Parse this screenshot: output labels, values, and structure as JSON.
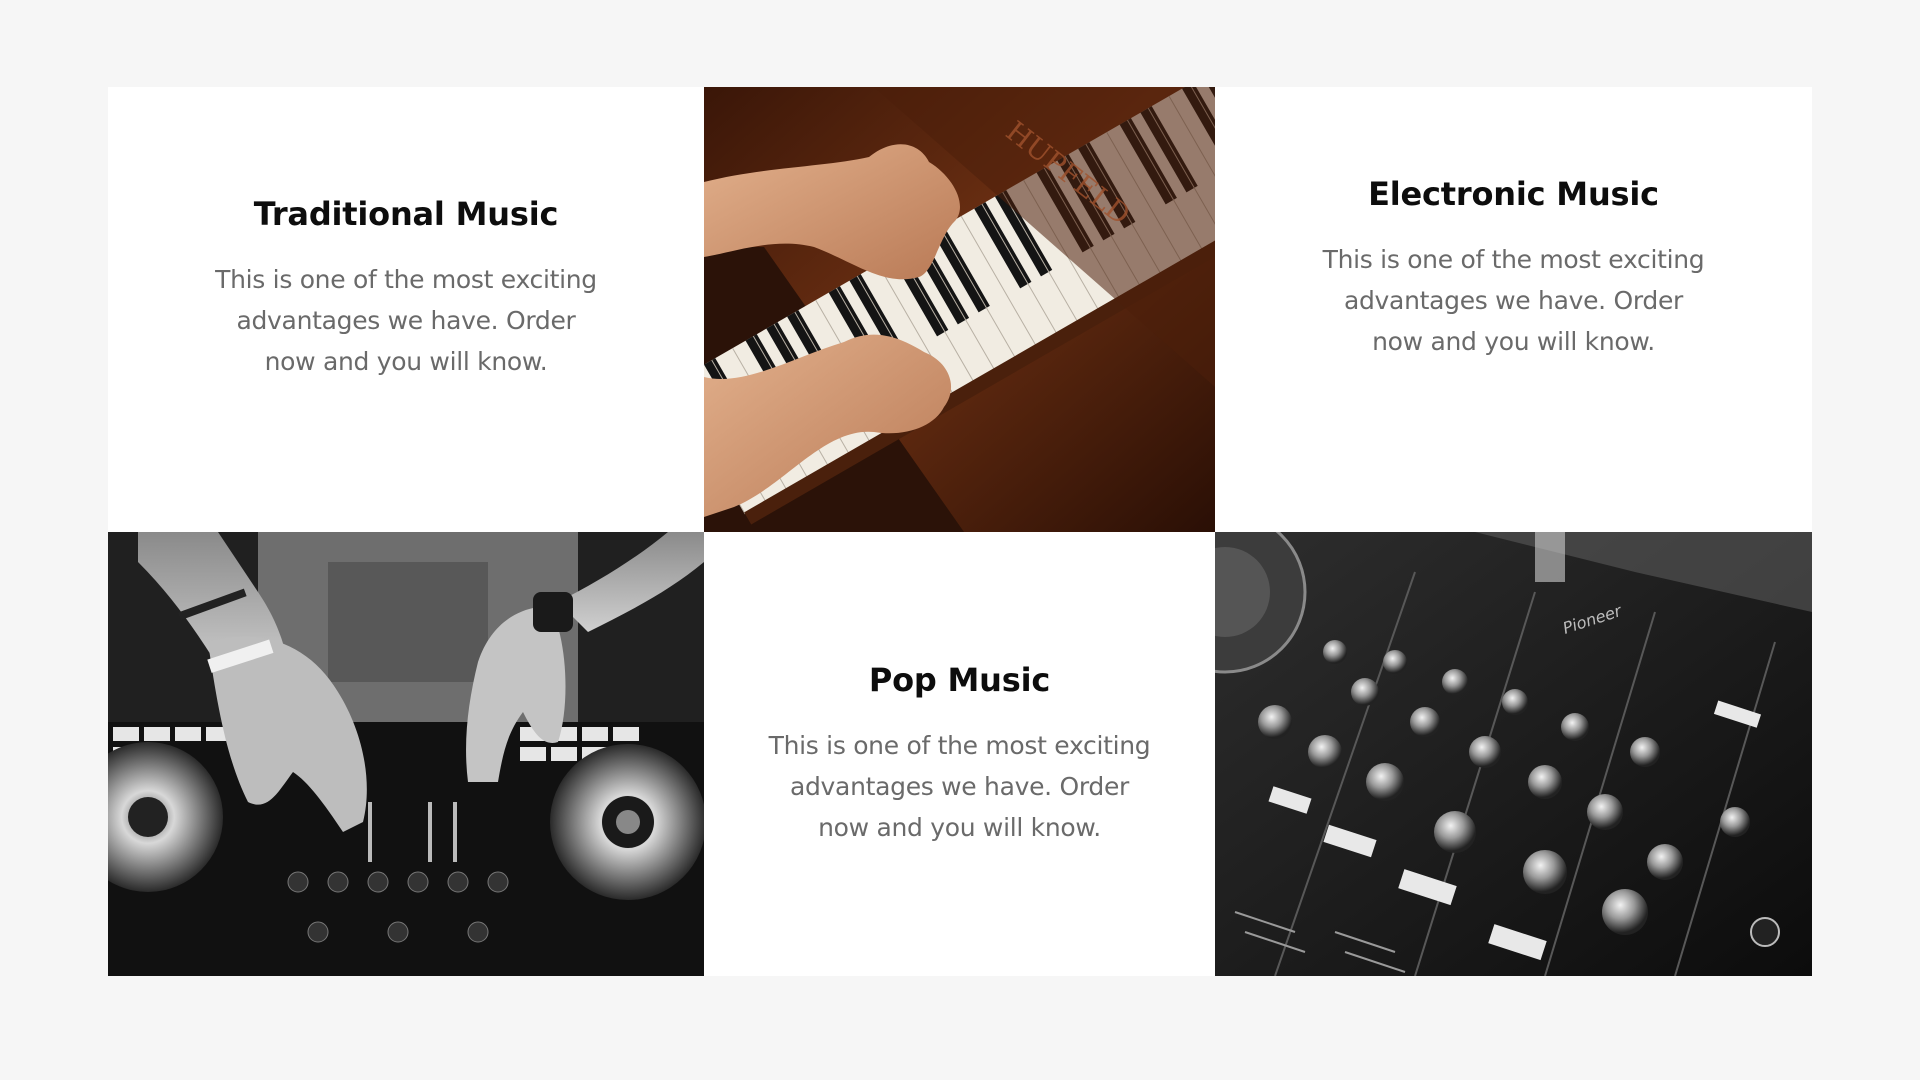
{
  "cards": [
    {
      "title": "Traditional Music",
      "body": "This is one of the most exciting advantages we have. Order now and you will know."
    },
    {
      "title": "Electronic Music",
      "body": "This is one of the most exciting advantages we have. Order now and you will know."
    },
    {
      "title": "Pop Music",
      "body": "This is one of the most exciting advantages we have. Order now and you will know."
    }
  ],
  "photos": {
    "piano_brand": "HUPFELD",
    "mixer_brand": "Pioneer"
  },
  "colors": {
    "page_background": "#f6f6f6",
    "card_background": "#ffffff",
    "title_color": "#0d0d0d",
    "body_color": "#6a6a6a",
    "piano_wood": "#5a2a12"
  }
}
